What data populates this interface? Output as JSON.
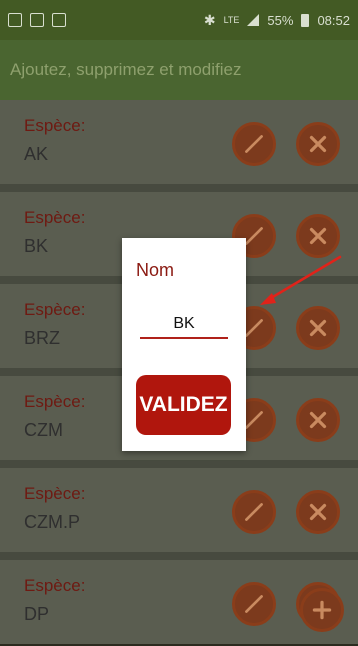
{
  "status_bar": {
    "network": "LTE",
    "battery": "55%",
    "time": "08:52"
  },
  "header": {
    "title": "Ajoutez, supprimez et modifiez"
  },
  "rows": [
    {
      "label": "Espèce:",
      "value": "AK"
    },
    {
      "label": "Espèce:",
      "value": "BK"
    },
    {
      "label": "Espèce:",
      "value": "BRZ"
    },
    {
      "label": "Espèce:",
      "value": "CZM"
    },
    {
      "label": "Espèce:",
      "value": "CZM.P"
    },
    {
      "label": "Espèce:",
      "value": "DP"
    }
  ],
  "dialog": {
    "title": "Nom",
    "input_value": "BK",
    "validate_label": "VALIDEZ"
  },
  "colors": {
    "accent": "#b0160d",
    "header_bg": "#4a6530",
    "label": "#6e1a12"
  },
  "icons": {
    "edit": "pencil-icon",
    "delete": "close-icon",
    "add": "plus-icon"
  }
}
